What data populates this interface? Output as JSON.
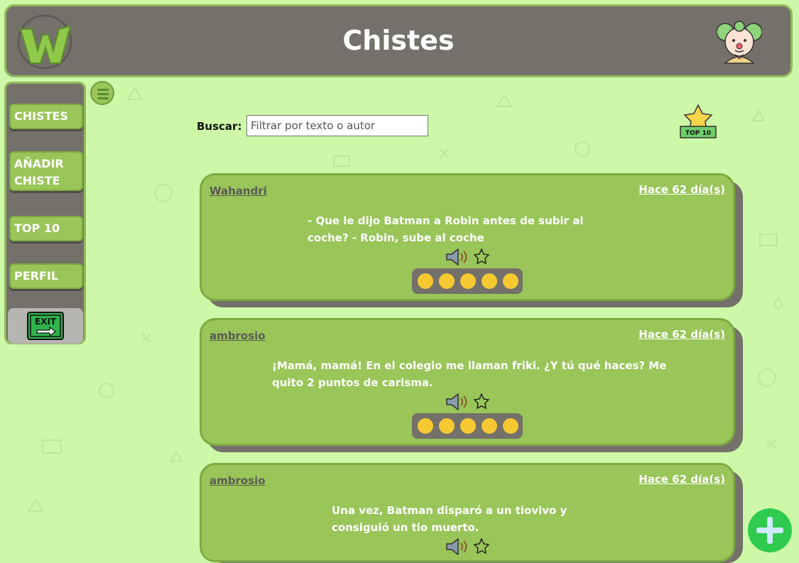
{
  "header": {
    "title": "Chistes"
  },
  "sidebar": {
    "items": [
      {
        "label": "CHISTES"
      },
      {
        "label": "AÑADIR CHISTE"
      },
      {
        "label": "TOP 10"
      },
      {
        "label": "PERFIL"
      }
    ],
    "exit_label": "EXIT"
  },
  "search": {
    "label": "Buscar:",
    "placeholder": "Filtrar por texto o autor"
  },
  "top10_badge": "TOP 10",
  "jokes": [
    {
      "author": "Wahandri",
      "date": "Hace 62 día(s)",
      "text": "- Que le dijo Batman a Robin antes de subir al coche? - Robin, sube al coche"
    },
    {
      "author": "ambrosio",
      "date": "Hace 62 día(s)",
      "text": "¡Mamá, mamá! En el colegio me llaman friki. ¿Y tú qué haces? Me quito 2 puntos de carisma."
    },
    {
      "author": "ambrosio",
      "date": "Hace 62 día(s)",
      "text": "Una vez, Batman disparó a un tiovivo y consiguió un tio muerto."
    }
  ],
  "icons": {
    "logo": "w-logo-icon",
    "clown": "clown-icon",
    "menu": "hamburger-icon",
    "speaker": "speaker-icon",
    "star": "star-icon",
    "add": "plus-icon",
    "exit": "exit-sign-icon",
    "reactions": [
      "confused-face-icon",
      "neutral-face-icon",
      "slight-smile-icon",
      "laughing-face-icon",
      "tears-of-joy-icon"
    ]
  },
  "colors": {
    "background": "#cdf8a8",
    "panel": "#74716a",
    "accent_green": "#99c559",
    "fab": "#2ecb4f"
  }
}
